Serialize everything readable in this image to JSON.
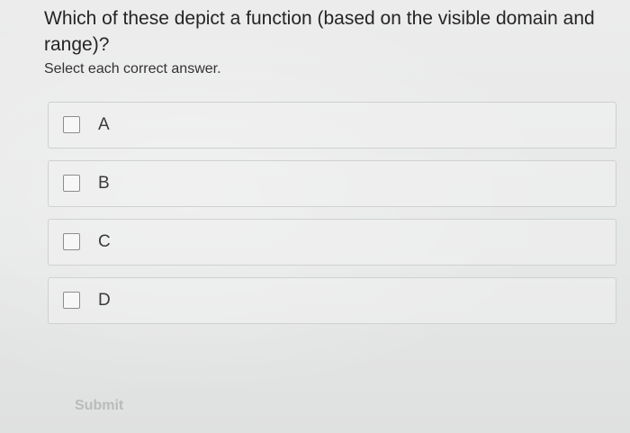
{
  "question": {
    "text": "Which of these depict a function (based on the visible domain and range)?",
    "instruction": "Select each correct answer."
  },
  "options": [
    {
      "label": "A",
      "checked": false
    },
    {
      "label": "B",
      "checked": false
    },
    {
      "label": "C",
      "checked": false
    },
    {
      "label": "D",
      "checked": false
    }
  ],
  "submit": {
    "label": "Submit",
    "enabled": false
  }
}
